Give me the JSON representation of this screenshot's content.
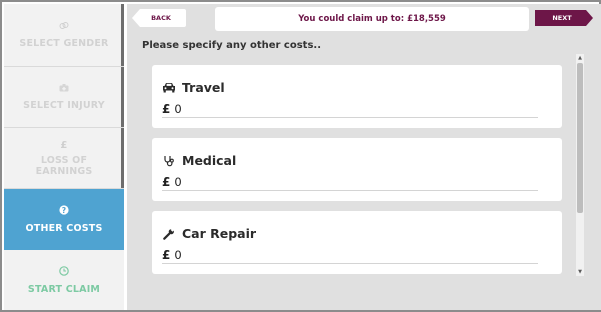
{
  "sidebar": {
    "items": [
      {
        "label": "SELECT GENDER",
        "icon": "gender-icon"
      },
      {
        "label": "SELECT INJURY",
        "icon": "injury-icon"
      },
      {
        "label": "LOSS OF EARNINGS",
        "icon": "pound-icon"
      },
      {
        "label": "OTHER COSTS",
        "icon": "question-icon",
        "active": true
      },
      {
        "label": "START CLAIM",
        "icon": "clock-icon"
      }
    ]
  },
  "header": {
    "back_label": "BACK",
    "claim_text": "You could claim up to: £18,559",
    "next_label": "NEXT"
  },
  "prompt": "Please specify any other costs..",
  "costs": [
    {
      "title": "Travel",
      "icon": "car-icon",
      "currency": "£",
      "value": "0"
    },
    {
      "title": "Medical",
      "icon": "stethoscope-icon",
      "currency": "£",
      "value": "0"
    },
    {
      "title": "Car Repair",
      "icon": "wrench-icon",
      "currency": "£",
      "value": "0"
    }
  ],
  "colors": {
    "accent_blue": "#4fa3d1",
    "brand_maroon": "#6d1648",
    "start_green": "#7dcaa3",
    "panel_gray": "#e0e0e0"
  }
}
